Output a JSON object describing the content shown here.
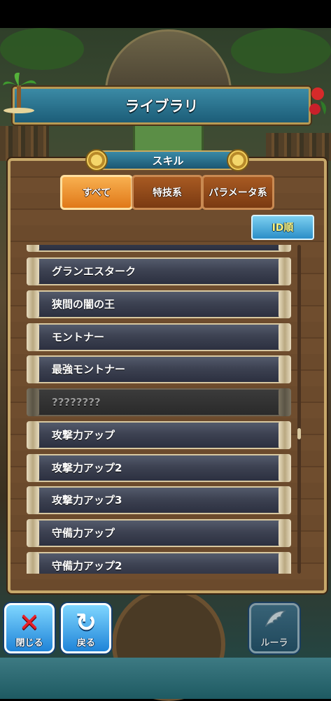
{
  "header": {
    "title": "ライブラリ"
  },
  "section": {
    "label": "スキル"
  },
  "tabs": [
    {
      "label": "すべて",
      "active": true
    },
    {
      "label": "特技系",
      "active": false
    },
    {
      "label": "パラメータ系",
      "active": false
    }
  ],
  "sort": {
    "label": "ID順"
  },
  "skills": [
    {
      "label": "グランエスターク",
      "locked": false
    },
    {
      "label": "狭間の闇の王",
      "locked": false
    },
    {
      "label": "モントナー",
      "locked": false
    },
    {
      "label": "最強モントナー",
      "locked": false
    },
    {
      "label": "????????",
      "locked": true
    },
    {
      "label": "攻撃力アップ",
      "locked": false
    },
    {
      "label": "攻撃力アップ2",
      "locked": false
    },
    {
      "label": "攻撃力アップ3",
      "locked": false
    },
    {
      "label": "守備力アップ",
      "locked": false
    },
    {
      "label": "守備力アップ2",
      "locked": false
    }
  ],
  "bottom": {
    "close_label": "閉じる",
    "back_label": "戻る",
    "rura_label": "ルーラ"
  },
  "colors": {
    "accent_teal": "#2a7a98",
    "tab_active": "#f09030",
    "tab_inactive": "#8a4a1a",
    "sort_button": "#3aa0e0"
  },
  "icons": {
    "close": "x-icon",
    "back": "return-arrow-icon",
    "rura": "wing-icon"
  }
}
